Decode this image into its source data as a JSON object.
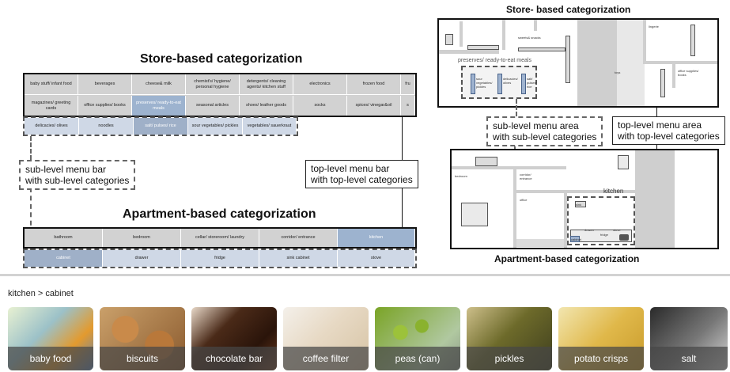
{
  "left_diagram": {
    "store_title": "Store-based categorization",
    "apartment_title": "Apartment-based categorization",
    "store_top_row1": [
      "baby stuff/ infant food",
      "beverages",
      "cheese& milk",
      "chemist's/ hygiene/ personal hygiene",
      "detergents/ cleaning agents/ kitchen stuff",
      "electronics",
      "frozen food",
      "fru"
    ],
    "store_top_row2": [
      "magazines/ greeting cards",
      "office supplies/ books",
      "preserves/ ready-to-eat meals",
      "seasonal articles",
      "shoes/ leather goods",
      "socks",
      "spices/ vinegar&oil",
      "s"
    ],
    "store_sub_row": [
      "delicacies/ olives",
      "noodles",
      "salt/ pulses/ rice",
      "sour vegetables/ pickles",
      "vegetables/ sauerkraut"
    ],
    "apt_top_row": [
      "bathroom",
      "bedroom",
      "cellar/ storeroom/ laundry",
      "corridor/ entrance",
      "kitchen"
    ],
    "apt_sub_row": [
      "cabinet",
      "drawer",
      "fridge",
      "sink cabinet",
      "stove"
    ],
    "sub_callout": [
      "sub-level menu bar",
      "with sub-level categories"
    ],
    "top_callout": [
      "top-level menu bar",
      "with top-level categories"
    ]
  },
  "right_diagram": {
    "store_title": "Store- based categorization",
    "apartment_title": "Apartment-based categorization",
    "store_plan_labels": {
      "preserves": "preserves/ ready-to-eat meals",
      "snacks": "sweets& snacks",
      "toys": "toys",
      "office": "office supplies/ books",
      "top": "lingerie",
      "col1": "sour vegetables/ pickles",
      "col2": "delicacies/ olives",
      "col3": "salt/ pulses/ rice"
    },
    "sub_callout": [
      "sub-level menu area",
      "with sub-level categories"
    ],
    "top_callout": [
      "top-level menu area",
      "with top-level categories"
    ],
    "apt_plan_labels": {
      "corridor": "corridor/ entrance",
      "bedroom": "bedroom",
      "office": "office",
      "kitchen": "kitchen",
      "sink": "sink",
      "fridge": "fridge",
      "drawer": "drawer",
      "stove": "stove",
      "cabinet": "cabinet"
    }
  },
  "breadcrumb": "kitchen > cabinet",
  "products": [
    {
      "label": "baby food"
    },
    {
      "label": "biscuits"
    },
    {
      "label": "chocolate bar"
    },
    {
      "label": "coffee filter"
    },
    {
      "label": "peas (can)"
    },
    {
      "label": "pickles"
    },
    {
      "label": "potato crisps"
    },
    {
      "label": "salt"
    }
  ],
  "colors": {
    "top_cell": "#d2d2d2",
    "sub_cell": "#cfd8e6",
    "selected_top": "#9db3cf",
    "selected_sub": "#9fb0c8",
    "shelf_blue": "#9fb3cf"
  }
}
